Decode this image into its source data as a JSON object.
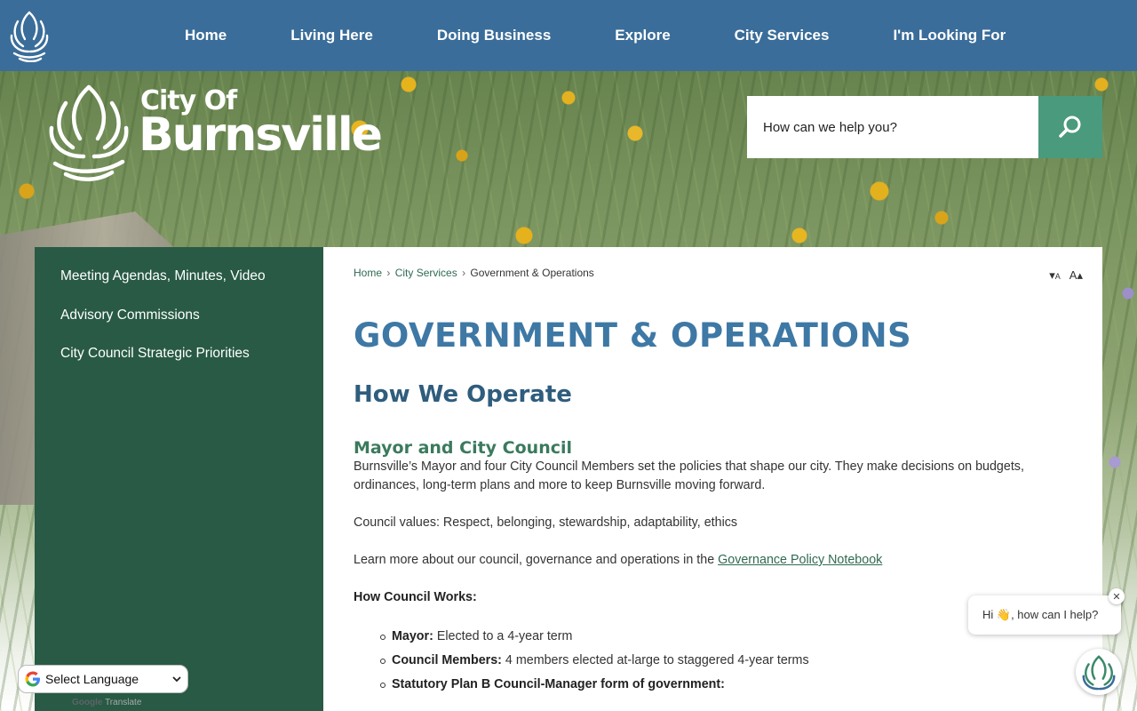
{
  "nav": {
    "items": [
      {
        "label": "Home"
      },
      {
        "label": "Living Here"
      },
      {
        "label": "Doing Business"
      },
      {
        "label": "Explore"
      },
      {
        "label": "City Services"
      },
      {
        "label": "I'm Looking For"
      }
    ]
  },
  "brand": {
    "line1": "City Of",
    "line2": "Burnsville"
  },
  "search": {
    "placeholder": "How can we help you?",
    "icon": "search-icon"
  },
  "sidebar": {
    "items": [
      {
        "label": "Meeting Agendas, Minutes, Video"
      },
      {
        "label": "Advisory Commissions"
      },
      {
        "label": "City Council Strategic Priorities"
      }
    ]
  },
  "breadcrumb": {
    "home": "Home",
    "sep": "›",
    "city_services": "City Services",
    "current": "Government & Operations"
  },
  "text_resize": {
    "decrease": "A",
    "increase": "A"
  },
  "content": {
    "page_title": "GOVERNMENT & OPERATIONS",
    "section_title": "How We Operate",
    "sub_title": "Mayor and City Council",
    "para1": "Burnsville’s Mayor and four City Council Members set the policies that shape our city. They make decisions on budgets, ordinances, long-term plans and more to keep Burnsville moving forward.",
    "para2": "Council values: Respect, belonging, stewardship, adaptability, ethics",
    "para3_prefix": "Learn more about our council, governance and operations in the ",
    "para3_link": "Governance Policy Notebook",
    "how_heading": "How Council Works:",
    "bullets": [
      {
        "term": "Mayor:",
        "text": " Elected to a 4-year term"
      },
      {
        "term": "Council Members:",
        "text": " 4 members elected at-large to staggered 4-year terms"
      },
      {
        "term": "Statutory Plan B Council-Manager form of government:",
        "text": ""
      }
    ]
  },
  "chat": {
    "greeting": "Hi 👋, how can I help?",
    "close": "✕"
  },
  "translate": {
    "label": "Select Language",
    "powered_google": "Google",
    "powered_translate": "Translate"
  },
  "colors": {
    "nav_bg": "#3a6d99",
    "sidebar_bg": "#285a45",
    "search_btn": "#4a9a7d",
    "title_blue": "#3e78a5",
    "sub_green": "#3b7a5e"
  }
}
